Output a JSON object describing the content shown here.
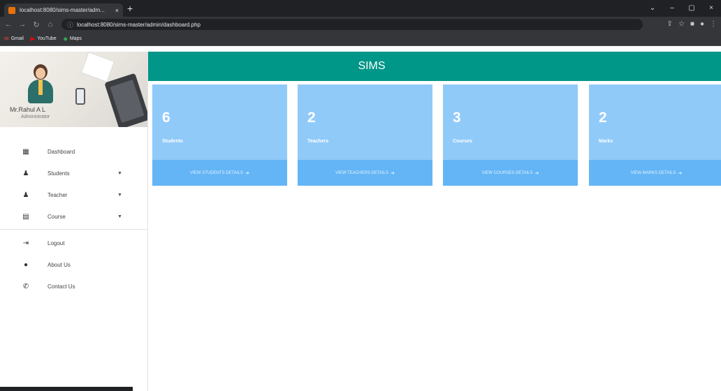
{
  "browser": {
    "tab_title": "localhost:8080/sims-master/adm...",
    "tab_close": "×",
    "new_tab": "+",
    "url": "localhost:8080/sims-master/admin/dashboard.php",
    "window_controls": [
      "⌄",
      "–",
      "▢",
      "×"
    ],
    "bookmarks": [
      {
        "label": "Gmail",
        "icon": "mail-icon"
      },
      {
        "label": "YouTube",
        "icon": "youtube-icon"
      },
      {
        "label": "Maps",
        "icon": "maps-icon"
      }
    ]
  },
  "header": {
    "brand": "SIMS"
  },
  "profile": {
    "name": "Mr.Rahul A L",
    "role": "Administrator"
  },
  "sidebar": {
    "items": [
      {
        "label": "Dashboard",
        "icon": "grid-icon",
        "caret": ""
      },
      {
        "label": "Students",
        "icon": "person-icon",
        "caret": "▼"
      },
      {
        "label": "Teacher",
        "icon": "person-icon",
        "caret": "▼"
      },
      {
        "label": "Course",
        "icon": "book-icon",
        "caret": "▼"
      },
      {
        "label": "Logout",
        "icon": "logout-icon",
        "caret": ""
      },
      {
        "label": "About Us",
        "icon": "info-icon",
        "caret": ""
      },
      {
        "label": "Contact Us",
        "icon": "phone-icon",
        "caret": ""
      }
    ]
  },
  "cards": [
    {
      "count": "6",
      "label": "Students",
      "link": "VIEW STUDENTS DETAILS"
    },
    {
      "count": "2",
      "label": "Teachers",
      "link": "VIEW TEACHERS DETAILS"
    },
    {
      "count": "3",
      "label": "Courses",
      "link": "VIEW COURSES DETAILS"
    },
    {
      "count": "2",
      "label": "Marks",
      "link": "VIEW MARKS DETAILS"
    }
  ],
  "colors": {
    "header": "#009688",
    "card": "#90caf9",
    "card_footer": "#64b5f6"
  }
}
